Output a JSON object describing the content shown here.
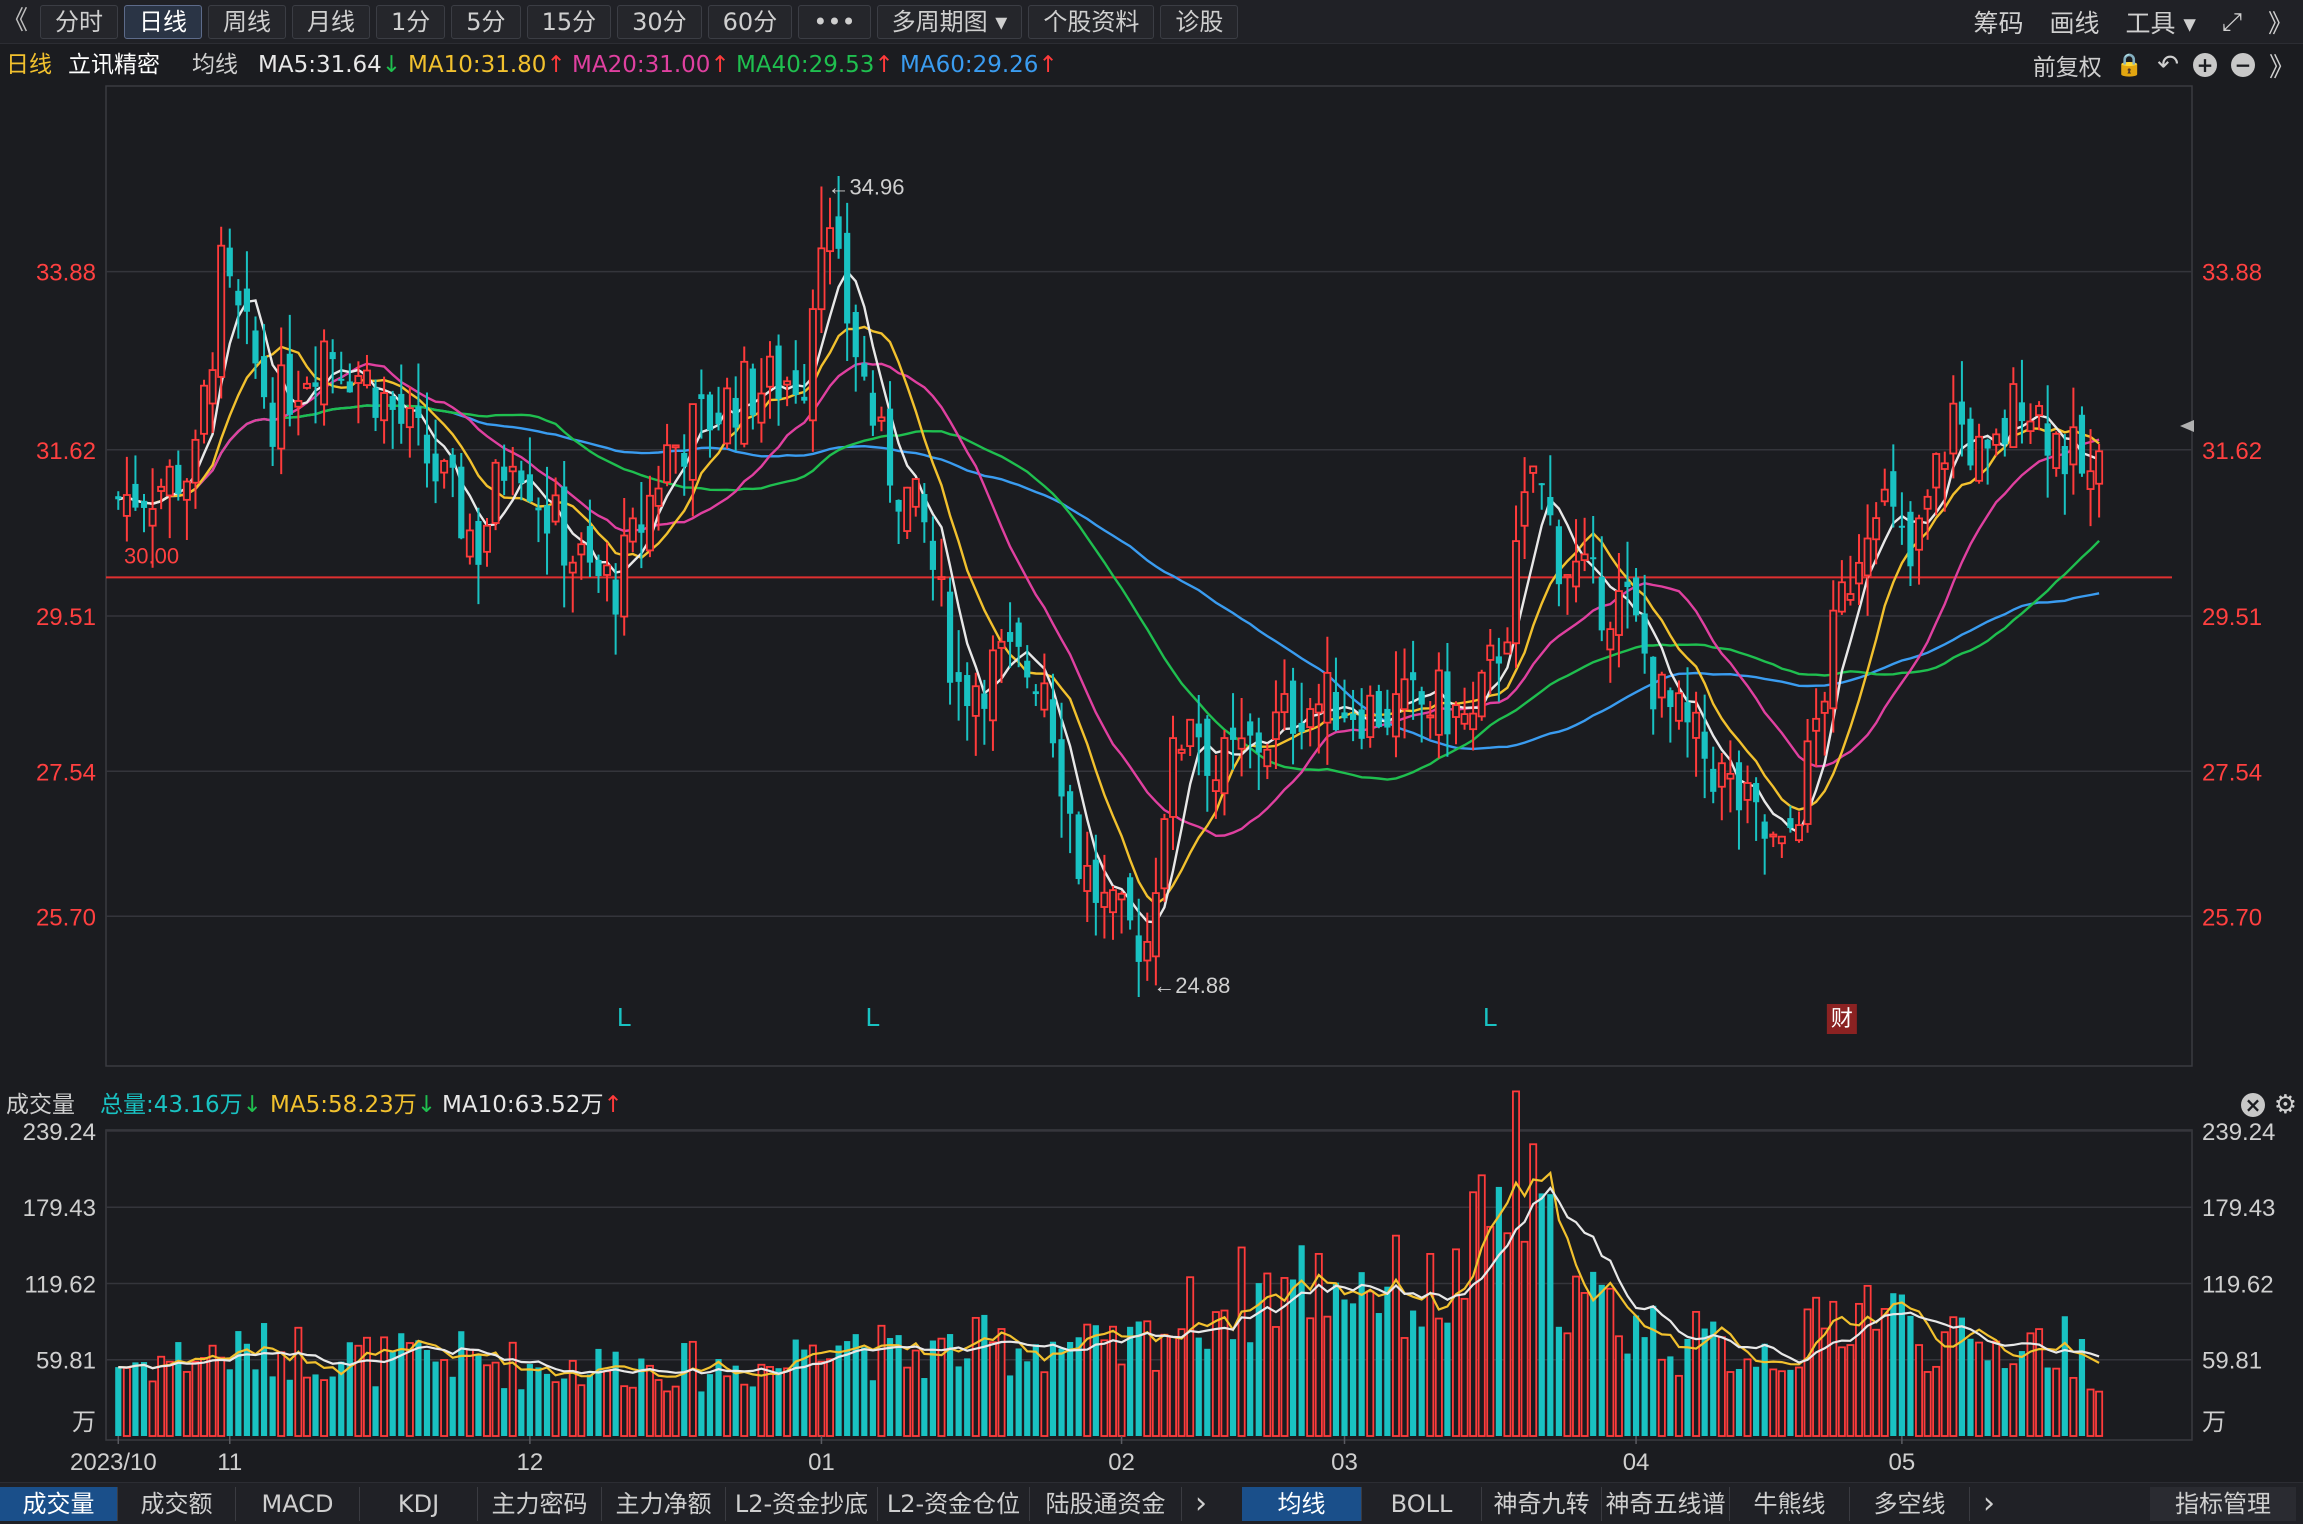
{
  "toolbar": {
    "collapse_glyph": "《",
    "tabs": [
      {
        "label": "分时"
      },
      {
        "label": "日线",
        "active": true
      },
      {
        "label": "周线"
      },
      {
        "label": "月线"
      },
      {
        "label": "1分"
      },
      {
        "label": "5分"
      },
      {
        "label": "15分"
      },
      {
        "label": "30分"
      },
      {
        "label": "60分"
      },
      {
        "label": "•••"
      },
      {
        "label": "多周期图 ▾"
      },
      {
        "label": "个股资料"
      },
      {
        "label": "诊股"
      }
    ],
    "right": [
      "筹码",
      "画线",
      "工具 ▾",
      "⤢",
      "》"
    ]
  },
  "indicator": {
    "period": "日线",
    "stock": "立讯精密",
    "label": "均线",
    "ma": [
      {
        "text": "MA5:31.64",
        "arrow": "↓",
        "color": "#e8e8e8",
        "arrow_color": "#1fbf4f"
      },
      {
        "text": "MA10:31.80",
        "arrow": "↑",
        "color": "#f2c12e",
        "arrow_color": "#ff3b3b"
      },
      {
        "text": "MA20:31.00",
        "arrow": "↑",
        "color": "#e040a0",
        "arrow_color": "#ff3b3b"
      },
      {
        "text": "MA40:29.53",
        "arrow": "↑",
        "color": "#1fbf4f",
        "arrow_color": "#ff3b3b"
      },
      {
        "text": "MA60:29.26",
        "arrow": "↑",
        "color": "#3a9cf0",
        "arrow_color": "#ff3b3b"
      }
    ],
    "adjust": "前复权"
  },
  "volume_header": {
    "title": "成交量",
    "total": "总量:43.16万",
    "total_arrow": "↓",
    "ma5": "MA5:58.23万",
    "ma5_arrow": "↓",
    "ma10": "MA10:63.52万",
    "ma10_arrow": "↑"
  },
  "bottom_tabs": {
    "left": [
      "成交量",
      "成交额",
      "MACD",
      "KDJ",
      "主力密码",
      "主力净额",
      "L2-资金抄底",
      "L2-资金仓位",
      "陆股通资金"
    ],
    "right": [
      "均线",
      "BOLL",
      "神奇九转",
      "神奇五线谱",
      "牛熊线",
      "多空线"
    ],
    "more": "›",
    "manage": "指标管理"
  },
  "chart_data": {
    "type": "candlestick",
    "price_ticks": [
      "33.88",
      "31.62",
      "29.51",
      "27.54",
      "25.70"
    ],
    "price_tick_values": [
      33.88,
      31.62,
      29.51,
      27.54,
      25.7
    ],
    "ylim": [
      23.8,
      35.5
    ],
    "reference_line": {
      "value": 30.0,
      "label": "30.00"
    },
    "high_marker": {
      "value": 34.96,
      "label": "←34.96",
      "index": 82
    },
    "low_marker": {
      "value": 24.88,
      "label": "←24.88",
      "index": 120
    },
    "markers": [
      {
        "index": 59,
        "label": "L",
        "kind": "L"
      },
      {
        "index": 88,
        "label": "L",
        "kind": "L"
      },
      {
        "index": 160,
        "label": "L",
        "kind": "L"
      },
      {
        "index": 201,
        "label": "财",
        "kind": "财"
      }
    ],
    "volume_ticks": [
      "239.24",
      "179.43",
      "119.62",
      "59.81"
    ],
    "volume_tick_values": [
      239.24,
      179.43,
      119.62,
      59.81
    ],
    "volume_unit": "万",
    "volume_ylim": [
      0,
      240
    ],
    "x_labels": [
      {
        "index": 0,
        "label": "2023/10"
      },
      {
        "index": 13,
        "label": "11"
      },
      {
        "index": 48,
        "label": "12"
      },
      {
        "index": 82,
        "label": "01"
      },
      {
        "index": 117,
        "label": "02"
      },
      {
        "index": 143,
        "label": "03"
      },
      {
        "index": 177,
        "label": "04"
      },
      {
        "index": 208,
        "label": "05"
      }
    ],
    "ma_colors": {
      "ma5": "#e8e8e8",
      "ma10": "#f2c12e",
      "ma20": "#e040a0",
      "ma40": "#1fbf4f",
      "ma60": "#3a9cf0"
    },
    "up_color": "#ff3b3b",
    "down_color": "#19c2c2",
    "n": 240,
    "anchors": [
      [
        0,
        31.0
      ],
      [
        5,
        31.2
      ],
      [
        9,
        31.4
      ],
      [
        12,
        33.8
      ],
      [
        18,
        32.1
      ],
      [
        24,
        33.0
      ],
      [
        30,
        32.4
      ],
      [
        36,
        31.5
      ],
      [
        42,
        30.4
      ],
      [
        46,
        31.8
      ],
      [
        50,
        30.8
      ],
      [
        55,
        30.0
      ],
      [
        58,
        29.9
      ],
      [
        60,
        30.4
      ],
      [
        64,
        31.6
      ],
      [
        72,
        32.3
      ],
      [
        80,
        32.6
      ],
      [
        82,
        34.6
      ],
      [
        86,
        32.9
      ],
      [
        89,
        31.6
      ],
      [
        94,
        30.6
      ],
      [
        98,
        28.6
      ],
      [
        103,
        28.9
      ],
      [
        108,
        28.8
      ],
      [
        112,
        26.4
      ],
      [
        116,
        25.6
      ],
      [
        120,
        25.4
      ],
      [
        122,
        27.2
      ],
      [
        125,
        28.4
      ],
      [
        128,
        27.5
      ],
      [
        134,
        28.0
      ],
      [
        138,
        28.4
      ],
      [
        143,
        28.4
      ],
      [
        148,
        28.3
      ],
      [
        154,
        28.4
      ],
      [
        158,
        28.1
      ],
      [
        162,
        29.5
      ],
      [
        165,
        31.4
      ],
      [
        168,
        30.3
      ],
      [
        172,
        29.8
      ],
      [
        176,
        29.6
      ],
      [
        180,
        28.4
      ],
      [
        186,
        27.6
      ],
      [
        190,
        27.0
      ],
      [
        194,
        26.4
      ],
      [
        197,
        27.6
      ],
      [
        201,
        29.7
      ],
      [
        205,
        31.2
      ],
      [
        209,
        30.1
      ],
      [
        214,
        32.1
      ],
      [
        218,
        31.3
      ],
      [
        222,
        32.4
      ],
      [
        227,
        31.6
      ],
      [
        230,
        31.2
      ],
      [
        231,
        31.3
      ]
    ],
    "volume_anchors": [
      [
        0,
        55
      ],
      [
        10,
        62
      ],
      [
        20,
        66
      ],
      [
        30,
        58
      ],
      [
        40,
        60
      ],
      [
        50,
        52
      ],
      [
        60,
        55
      ],
      [
        70,
        52
      ],
      [
        78,
        55
      ],
      [
        82,
        88
      ],
      [
        90,
        60
      ],
      [
        100,
        68
      ],
      [
        110,
        72
      ],
      [
        116,
        62
      ],
      [
        120,
        75
      ],
      [
        126,
        95
      ],
      [
        132,
        110
      ],
      [
        138,
        118
      ],
      [
        146,
        122
      ],
      [
        152,
        105
      ],
      [
        156,
        115
      ],
      [
        160,
        165
      ],
      [
        163,
        200
      ],
      [
        166,
        155
      ],
      [
        170,
        105
      ],
      [
        176,
        90
      ],
      [
        182,
        72
      ],
      [
        190,
        65
      ],
      [
        196,
        68
      ],
      [
        201,
        95
      ],
      [
        205,
        105
      ],
      [
        210,
        78
      ],
      [
        216,
        65
      ],
      [
        222,
        72
      ],
      [
        228,
        68
      ],
      [
        231,
        50
      ]
    ]
  }
}
